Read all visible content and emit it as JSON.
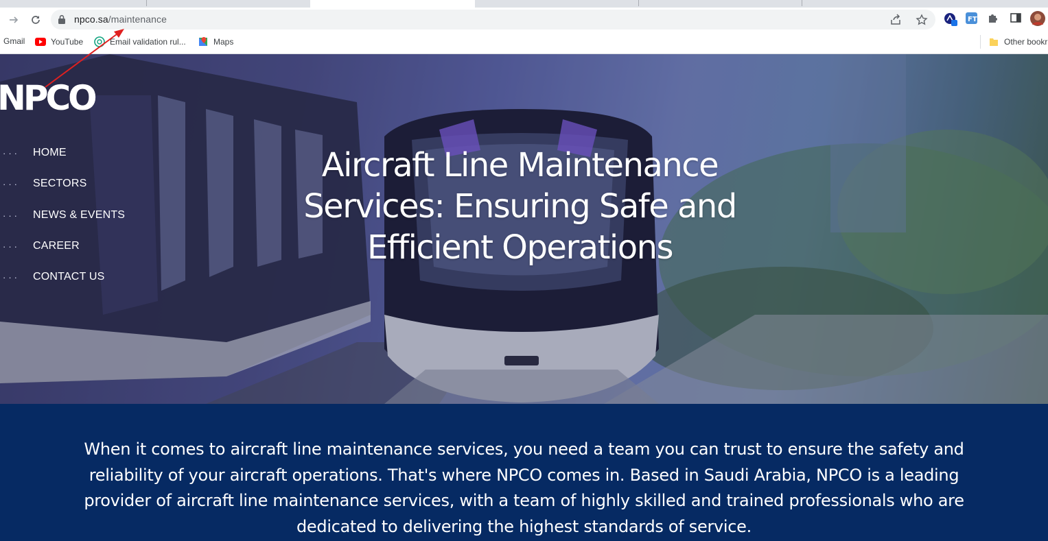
{
  "browser": {
    "url_host": "npco.sa",
    "url_path": "/maintenance",
    "bookmarks": [
      {
        "label": "Gmail",
        "icon": "gmail-icon"
      },
      {
        "label": "YouTube",
        "icon": "youtube-icon"
      },
      {
        "label": "Email validation rul...",
        "icon": "chatgpt-icon"
      },
      {
        "label": "Maps",
        "icon": "maps-icon"
      }
    ],
    "other_bookmarks": "Other bookr",
    "extensions": [
      "extension-a-icon",
      "extension-ft-icon",
      "puzzle-icon"
    ],
    "colors": {
      "youtube": "#ff0000",
      "folder": "#fbd25a",
      "ft_ext": "#1a73e8"
    }
  },
  "site": {
    "logo_text": "NPCO",
    "nav": [
      {
        "label": "HOME"
      },
      {
        "label": "SECTORS"
      },
      {
        "label": "NEWS & EVENTS"
      },
      {
        "label": "CAREER"
      },
      {
        "label": "CONTACT US"
      }
    ],
    "hero_title": "Aircraft Line Maintenance Services: Ensuring Safe and Efficient Operations",
    "intro_text": "When it comes to aircraft line maintenance services, you need a team you can trust to ensure the safety and reliability of your aircraft operations. That's where NPCO comes in. Based in Saudi Arabia, NPCO is a leading provider of aircraft line maintenance services, with a team of highly skilled and trained professionals who are dedicated to delivering the highest standards of service.",
    "colors": {
      "intro_bg": "#062a63",
      "annotation_arrow": "#e02020"
    }
  }
}
